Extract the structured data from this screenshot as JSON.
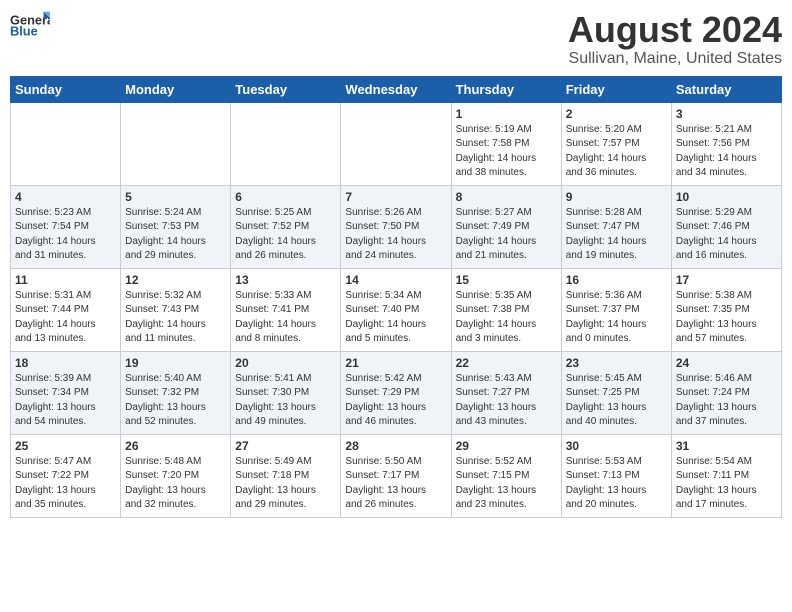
{
  "header": {
    "logo_general": "General",
    "logo_blue": "Blue",
    "month_title": "August 2024",
    "location": "Sullivan, Maine, United States"
  },
  "days_of_week": [
    "Sunday",
    "Monday",
    "Tuesday",
    "Wednesday",
    "Thursday",
    "Friday",
    "Saturday"
  ],
  "weeks": [
    [
      {
        "day": "",
        "info": ""
      },
      {
        "day": "",
        "info": ""
      },
      {
        "day": "",
        "info": ""
      },
      {
        "day": "",
        "info": ""
      },
      {
        "day": "1",
        "info": "Sunrise: 5:19 AM\nSunset: 7:58 PM\nDaylight: 14 hours\nand 38 minutes."
      },
      {
        "day": "2",
        "info": "Sunrise: 5:20 AM\nSunset: 7:57 PM\nDaylight: 14 hours\nand 36 minutes."
      },
      {
        "day": "3",
        "info": "Sunrise: 5:21 AM\nSunset: 7:56 PM\nDaylight: 14 hours\nand 34 minutes."
      }
    ],
    [
      {
        "day": "4",
        "info": "Sunrise: 5:23 AM\nSunset: 7:54 PM\nDaylight: 14 hours\nand 31 minutes."
      },
      {
        "day": "5",
        "info": "Sunrise: 5:24 AM\nSunset: 7:53 PM\nDaylight: 14 hours\nand 29 minutes."
      },
      {
        "day": "6",
        "info": "Sunrise: 5:25 AM\nSunset: 7:52 PM\nDaylight: 14 hours\nand 26 minutes."
      },
      {
        "day": "7",
        "info": "Sunrise: 5:26 AM\nSunset: 7:50 PM\nDaylight: 14 hours\nand 24 minutes."
      },
      {
        "day": "8",
        "info": "Sunrise: 5:27 AM\nSunset: 7:49 PM\nDaylight: 14 hours\nand 21 minutes."
      },
      {
        "day": "9",
        "info": "Sunrise: 5:28 AM\nSunset: 7:47 PM\nDaylight: 14 hours\nand 19 minutes."
      },
      {
        "day": "10",
        "info": "Sunrise: 5:29 AM\nSunset: 7:46 PM\nDaylight: 14 hours\nand 16 minutes."
      }
    ],
    [
      {
        "day": "11",
        "info": "Sunrise: 5:31 AM\nSunset: 7:44 PM\nDaylight: 14 hours\nand 13 minutes."
      },
      {
        "day": "12",
        "info": "Sunrise: 5:32 AM\nSunset: 7:43 PM\nDaylight: 14 hours\nand 11 minutes."
      },
      {
        "day": "13",
        "info": "Sunrise: 5:33 AM\nSunset: 7:41 PM\nDaylight: 14 hours\nand 8 minutes."
      },
      {
        "day": "14",
        "info": "Sunrise: 5:34 AM\nSunset: 7:40 PM\nDaylight: 14 hours\nand 5 minutes."
      },
      {
        "day": "15",
        "info": "Sunrise: 5:35 AM\nSunset: 7:38 PM\nDaylight: 14 hours\nand 3 minutes."
      },
      {
        "day": "16",
        "info": "Sunrise: 5:36 AM\nSunset: 7:37 PM\nDaylight: 14 hours\nand 0 minutes."
      },
      {
        "day": "17",
        "info": "Sunrise: 5:38 AM\nSunset: 7:35 PM\nDaylight: 13 hours\nand 57 minutes."
      }
    ],
    [
      {
        "day": "18",
        "info": "Sunrise: 5:39 AM\nSunset: 7:34 PM\nDaylight: 13 hours\nand 54 minutes."
      },
      {
        "day": "19",
        "info": "Sunrise: 5:40 AM\nSunset: 7:32 PM\nDaylight: 13 hours\nand 52 minutes."
      },
      {
        "day": "20",
        "info": "Sunrise: 5:41 AM\nSunset: 7:30 PM\nDaylight: 13 hours\nand 49 minutes."
      },
      {
        "day": "21",
        "info": "Sunrise: 5:42 AM\nSunset: 7:29 PM\nDaylight: 13 hours\nand 46 minutes."
      },
      {
        "day": "22",
        "info": "Sunrise: 5:43 AM\nSunset: 7:27 PM\nDaylight: 13 hours\nand 43 minutes."
      },
      {
        "day": "23",
        "info": "Sunrise: 5:45 AM\nSunset: 7:25 PM\nDaylight: 13 hours\nand 40 minutes."
      },
      {
        "day": "24",
        "info": "Sunrise: 5:46 AM\nSunset: 7:24 PM\nDaylight: 13 hours\nand 37 minutes."
      }
    ],
    [
      {
        "day": "25",
        "info": "Sunrise: 5:47 AM\nSunset: 7:22 PM\nDaylight: 13 hours\nand 35 minutes."
      },
      {
        "day": "26",
        "info": "Sunrise: 5:48 AM\nSunset: 7:20 PM\nDaylight: 13 hours\nand 32 minutes."
      },
      {
        "day": "27",
        "info": "Sunrise: 5:49 AM\nSunset: 7:18 PM\nDaylight: 13 hours\nand 29 minutes."
      },
      {
        "day": "28",
        "info": "Sunrise: 5:50 AM\nSunset: 7:17 PM\nDaylight: 13 hours\nand 26 minutes."
      },
      {
        "day": "29",
        "info": "Sunrise: 5:52 AM\nSunset: 7:15 PM\nDaylight: 13 hours\nand 23 minutes."
      },
      {
        "day": "30",
        "info": "Sunrise: 5:53 AM\nSunset: 7:13 PM\nDaylight: 13 hours\nand 20 minutes."
      },
      {
        "day": "31",
        "info": "Sunrise: 5:54 AM\nSunset: 7:11 PM\nDaylight: 13 hours\nand 17 minutes."
      }
    ]
  ]
}
